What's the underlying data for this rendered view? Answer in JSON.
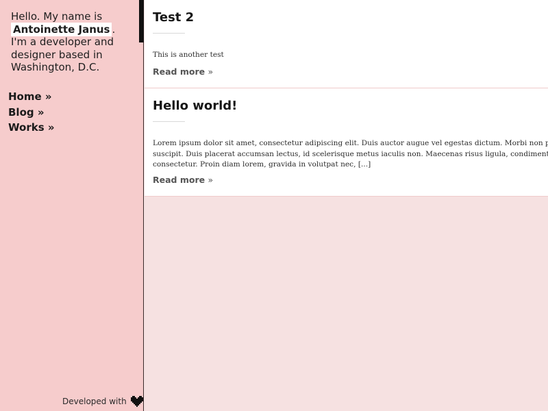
{
  "sidebar": {
    "intro_before": "Hello. My name is",
    "author_name": "Antoinette Janus",
    "intro_after": ". I'm a developer and designer based in Washington, D.C.",
    "nav": [
      {
        "label": "Home »"
      },
      {
        "label": "Blog »"
      },
      {
        "label": "Works »"
      }
    ],
    "footer_text": "Developed with",
    "footer_icon": "heart-icon"
  },
  "posts": [
    {
      "title": "Test 2",
      "excerpt_lines": [
        "This is another test"
      ],
      "read_more": "Read more",
      "read_more_suffix": "»"
    },
    {
      "title": "Hello world!",
      "excerpt_lines": [
        "Lorem ipsum dolor sit amet, consectetur adipiscing elit. Duis auctor augue vel egestas dictum. Morbi non placerat ne",
        "suscipit. Duis placerat accumsan lectus, id scelerisque metus iaculis non. Maecenas risus ligula, condimentum a soda",
        "consectetur. Proin diam lorem, gravida in volutpat nec, [...]"
      ],
      "read_more": "Read more",
      "read_more_suffix": "»"
    }
  ],
  "colors": {
    "sidebar_bg": "#f6cccc",
    "main_bg": "#f6e1e1",
    "post_bg": "#ffffff",
    "accent": "#111111"
  }
}
